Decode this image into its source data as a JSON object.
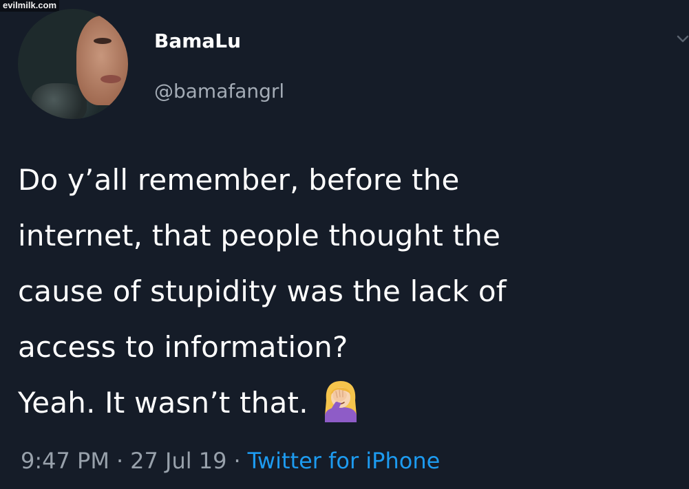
{
  "watermark": "evilmilk.com",
  "tweet": {
    "display_name": "BamaLu",
    "handle": "@bamafangrl",
    "body_lines": [
      "Do y’all remember, before the",
      "internet, that people thought the",
      "cause of stupidity was the lack of",
      "access to information?",
      "Yeah.  It wasn’t that."
    ],
    "emoji": "woman-facepalming-emoji",
    "time": "9:47 PM",
    "date": "27 Jul 19",
    "separator": "·",
    "source": "Twitter for iPhone"
  },
  "colors": {
    "background": "#151c28",
    "text": "#ffffff",
    "secondary_text": "#98a1ab",
    "link": "#1d9bf0"
  },
  "icons": {
    "menu": "chevron-down-icon"
  }
}
